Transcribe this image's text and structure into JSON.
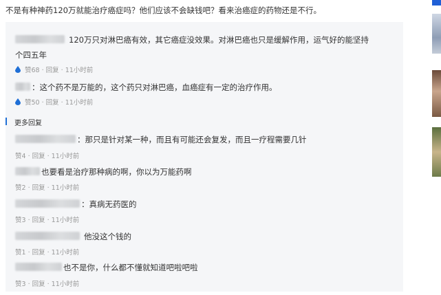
{
  "question": "不是有种神药120万就能治疗癌症吗？他们应该不会缺钱吧？看来治癌症的药物还是不行。",
  "top_comments": [
    {
      "text_line1": "120万只对淋巴癌有效，其它癌症没效果。对淋巴癌也只是缓解作用，运气好的能坚持",
      "text_line2": "个四五年",
      "meta": "赞68 · 回复 · 11小时前"
    },
    {
      "text_line1": "：这个药不是万能的，这个药只对淋巴癌，血癌症有一定的治疗作用。",
      "meta": "赞50 · 回复 · 11小时前"
    }
  ],
  "more_replies_label": "更多回复",
  "replies": [
    {
      "text": "：那只是针对某一种，而且有可能还会复发，而且一疗程需要几针",
      "meta": "赞4 · 回复 · 11小时前"
    },
    {
      "text": "也要看是治疗那种病的啊，你以为万能药啊",
      "meta": "赞2 · 回复 · 11小时前"
    },
    {
      "text": "：真病无药医的",
      "meta": "赞3 · 回复 · 11小时前"
    },
    {
      "text": "他没这个钱的",
      "meta": "赞1 · 回复 · 11小时前"
    },
    {
      "text": "也不是你，什么都不懂就知道吧啦吧啦",
      "meta": "赞3 · 回复 · 11小时前"
    }
  ],
  "colors": {
    "accent": "#1f6fd6",
    "panel_bg": "#f5f6f8",
    "meta_text": "#999999"
  },
  "icons": {
    "like": "water-drop-icon"
  }
}
